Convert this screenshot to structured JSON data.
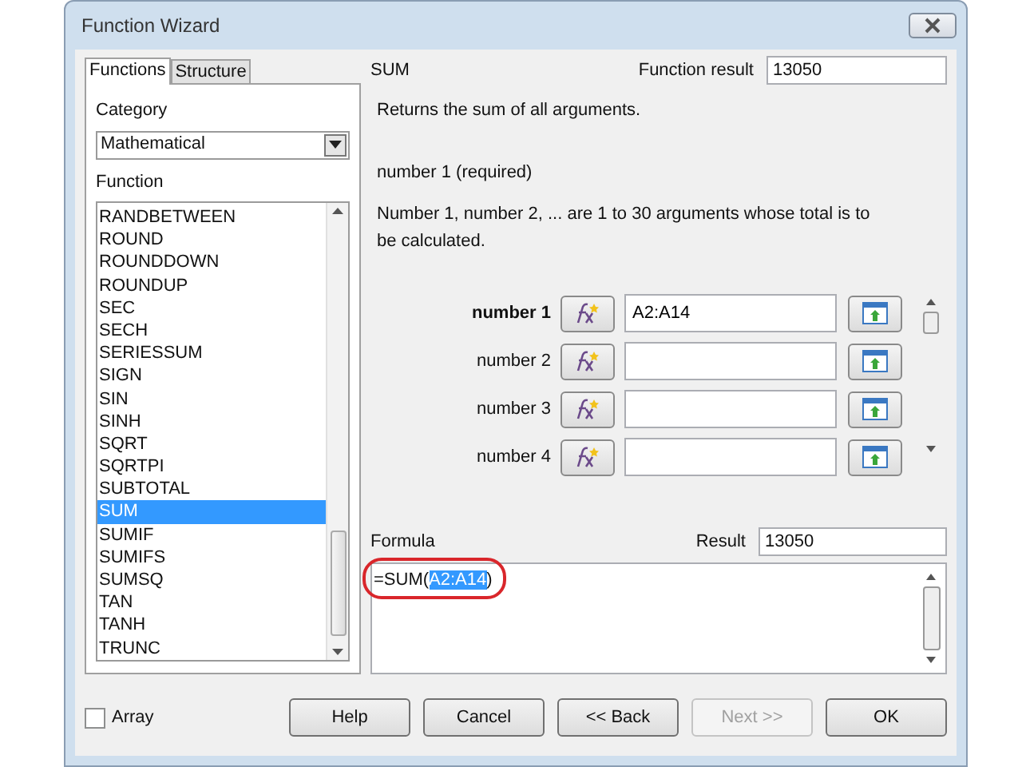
{
  "window": {
    "title": "Function Wizard"
  },
  "tabs": [
    {
      "label": "Functions",
      "selected": true
    },
    {
      "label": "Structure",
      "selected": false
    }
  ],
  "category": {
    "label": "Category",
    "value": "Mathematical"
  },
  "function_list": {
    "label": "Function",
    "items": [
      {
        "label": "RANDBETWEEN",
        "selected": false
      },
      {
        "label": "ROUND",
        "selected": false
      },
      {
        "label": "ROUNDDOWN",
        "selected": false
      },
      {
        "label": "ROUNDUP",
        "selected": false
      },
      {
        "label": "SEC",
        "selected": false
      },
      {
        "label": "SECH",
        "selected": false
      },
      {
        "label": "SERIESSUM",
        "selected": false
      },
      {
        "label": "SIGN",
        "selected": false
      },
      {
        "label": "SIN",
        "selected": false
      },
      {
        "label": "SINH",
        "selected": false
      },
      {
        "label": "SQRT",
        "selected": false
      },
      {
        "label": "SQRTPI",
        "selected": false
      },
      {
        "label": "SUBTOTAL",
        "selected": false
      },
      {
        "label": "SUM",
        "selected": true
      },
      {
        "label": "SUMIF",
        "selected": false
      },
      {
        "label": "SUMIFS",
        "selected": false
      },
      {
        "label": "SUMSQ",
        "selected": false
      },
      {
        "label": "TAN",
        "selected": false
      },
      {
        "label": "TANH",
        "selected": false
      },
      {
        "label": "TRUNC",
        "selected": false
      }
    ]
  },
  "function_name": "SUM",
  "function_result": {
    "label": "Function result",
    "value": "13050"
  },
  "description": "Returns the sum of all arguments.",
  "argument_title": "number 1 (required)",
  "argument_description": "Number 1, number 2, ... are 1 to 30 arguments whose total is to be calculated.",
  "arguments": [
    {
      "label": "number 1",
      "value": "A2:A14",
      "selected": true
    },
    {
      "label": "number 2",
      "selected": false
    },
    {
      "label": "number 3",
      "selected": false
    },
    {
      "label": "number 4",
      "selected": false
    }
  ],
  "formula": {
    "label": "Formula",
    "circled": true,
    "segments": [
      {
        "text": "=SUM(",
        "selected": false
      },
      {
        "text": "A2:A14",
        "selected": true
      },
      {
        "text": ")",
        "selected": false
      }
    ]
  },
  "result": {
    "label": "Result",
    "value": "13050"
  },
  "array": {
    "label": "Array",
    "checked": false
  },
  "buttons": [
    {
      "label": "Help",
      "disabled": false
    },
    {
      "label": "Cancel",
      "disabled": false
    },
    {
      "label": "<< Back",
      "disabled": false
    },
    {
      "label": "Next >>",
      "disabled": true
    },
    {
      "label": "OK",
      "disabled": false
    }
  ]
}
